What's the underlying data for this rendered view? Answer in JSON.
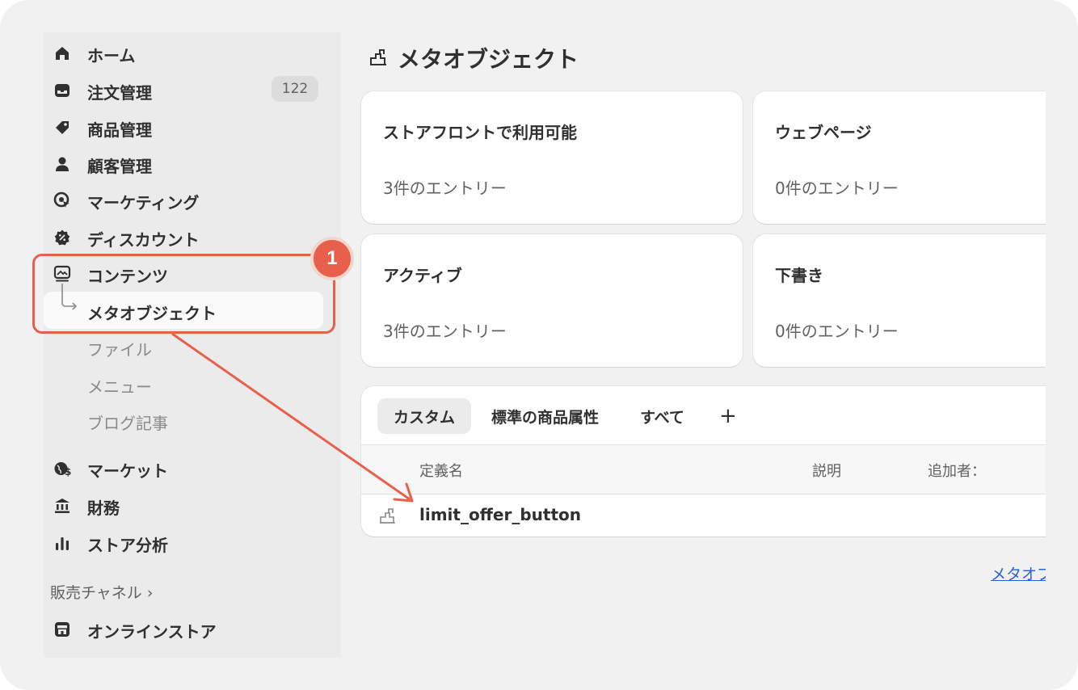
{
  "sidebar": {
    "items": [
      {
        "label": "ホーム",
        "icon": "home-icon"
      },
      {
        "label": "注文管理",
        "icon": "inbox-icon",
        "badge": "122"
      },
      {
        "label": "商品管理",
        "icon": "tag-icon"
      },
      {
        "label": "顧客管理",
        "icon": "person-icon"
      },
      {
        "label": "マーケティング",
        "icon": "target-icon"
      },
      {
        "label": "ディスカウント",
        "icon": "discount-icon"
      },
      {
        "label": "コンテンツ",
        "icon": "content-icon"
      },
      {
        "label": "メタオブジェクト",
        "icon": "subnav-arrow-icon",
        "active": true
      },
      {
        "label": "ファイル"
      },
      {
        "label": "メニュー"
      },
      {
        "label": "ブログ記事"
      },
      {
        "label": "マーケット",
        "icon": "globe-icon"
      },
      {
        "label": "財務",
        "icon": "bank-icon"
      },
      {
        "label": "ストア分析",
        "icon": "chart-icon"
      }
    ],
    "sales_channel_label": "販売チャネル ›",
    "channel_item": {
      "label": "オンラインストア",
      "icon": "store-icon"
    }
  },
  "annotation": {
    "step_number": "1",
    "color": "#e8604c"
  },
  "main": {
    "title": "メタオブジェクト",
    "cards": [
      {
        "title": "ストアフロントで利用可能",
        "subtitle": "3件のエントリー"
      },
      {
        "title": "ウェブページ",
        "subtitle": "0件のエントリー"
      },
      {
        "title": "アクティブ",
        "subtitle": "3件のエントリー"
      },
      {
        "title": "下書き",
        "subtitle": "0件のエントリー"
      }
    ],
    "tabs": [
      "カスタム",
      "標準の商品属性",
      "すべて",
      "+"
    ],
    "table": {
      "headers": [
        "定義名",
        "説明",
        "追加者："
      ],
      "rows": [
        {
          "name": "limit_offer_button"
        }
      ]
    },
    "footer_link": "メタオブジェクト"
  }
}
